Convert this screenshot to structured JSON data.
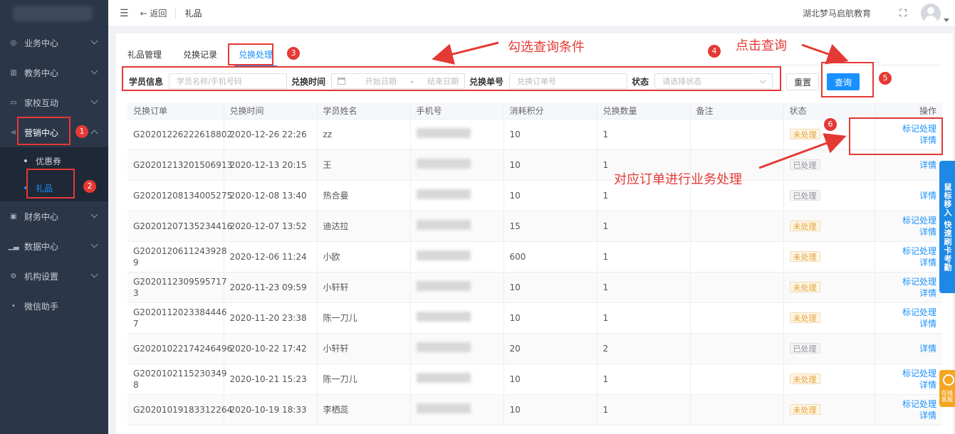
{
  "sidebar": {
    "items": [
      {
        "label": "业务中心",
        "icon": "briefcase-icon"
      },
      {
        "label": "教务中心",
        "icon": "book-icon"
      },
      {
        "label": "家校互动",
        "icon": "chat-icon"
      },
      {
        "label": "营销中心",
        "icon": "share-icon"
      },
      {
        "label": "财务中心",
        "icon": "wallet-icon"
      },
      {
        "label": "数据中心",
        "icon": "chart-icon"
      },
      {
        "label": "机构设置",
        "icon": "gear-icon"
      },
      {
        "label": "微信助手",
        "icon": "dot-icon"
      }
    ],
    "sub_items": [
      "优惠券",
      "礼品"
    ]
  },
  "header": {
    "back_label": "← 返回",
    "crumb": "礼品",
    "org_name": "湖北梦马启航教育"
  },
  "tabs": [
    "礼品管理",
    "兑换记录",
    "兑换处理"
  ],
  "filters": {
    "student_label": "学员信息",
    "student_placeholder": "学员名称/手机号码",
    "time_label": "兑换时间",
    "start_placeholder": "开始日期",
    "range_sep": "-",
    "end_placeholder": "结束日期",
    "order_label": "兑换单号",
    "order_placeholder": "兑换订单号",
    "status_label": "状态",
    "status_placeholder": "请选择状态",
    "reset_label": "重置",
    "query_label": "查询"
  },
  "table": {
    "headers": [
      "兑换订单",
      "兑换时间",
      "学员姓名",
      "手机号",
      "消耗积分",
      "兑换数量",
      "备注",
      "状态",
      "操作"
    ],
    "rows": [
      {
        "order": "G20201226222618802",
        "time": "2020-12-26 22:26",
        "name": "zz",
        "points": "10",
        "qty": "1",
        "status": "未处理",
        "mark": "标记处理",
        "detail": "详情"
      },
      {
        "order": "G20201213201506913",
        "time": "2020-12-13 20:15",
        "name": "王",
        "points": "10",
        "qty": "1",
        "status": "已处理",
        "mark": "",
        "detail": "详情"
      },
      {
        "order": "G20201208134005275",
        "time": "2020-12-08 13:40",
        "name": "热合曼",
        "points": "10",
        "qty": "1",
        "status": "已处理",
        "mark": "",
        "detail": "详情"
      },
      {
        "order": "G20201207135234416",
        "time": "2020-12-07 13:52",
        "name": "迪达拉",
        "points": "15",
        "qty": "1",
        "status": "未处理",
        "mark": "标记处理",
        "detail": "详情"
      },
      {
        "order": "G2020120611243928 9",
        "time": "2020-12-06 11:24",
        "name": "小欧",
        "points": "600",
        "qty": "1",
        "status": "未处理",
        "mark": "标记处理",
        "detail": "详情"
      },
      {
        "order": "G2020112309595717 3",
        "time": "2020-11-23 09:59",
        "name": "小轩轩",
        "points": "10",
        "qty": "1",
        "status": "未处理",
        "mark": "标记处理",
        "detail": "详情"
      },
      {
        "order": "G2020112023384446 7",
        "time": "2020-11-20 23:38",
        "name": "陈一刀儿",
        "points": "10",
        "qty": "1",
        "status": "未处理",
        "mark": "标记处理",
        "detail": "详情"
      },
      {
        "order": "G20201022174246496",
        "time": "2020-10-22 17:42",
        "name": "小轩轩",
        "points": "20",
        "qty": "2",
        "status": "已处理",
        "mark": "",
        "detail": "详情"
      },
      {
        "order": "G2020102115230349 8",
        "time": "2020-10-21 15:23",
        "name": "陈一刀儿",
        "points": "10",
        "qty": "1",
        "status": "未处理",
        "mark": "标记处理",
        "detail": "详情"
      },
      {
        "order": "G20201019183312264",
        "time": "2020-10-19 18:33",
        "name": "李栖蕊",
        "points": "10",
        "qty": "1",
        "status": "未处理",
        "mark": "标记处理",
        "detail": "详情"
      }
    ]
  },
  "annotations": {
    "filter_hint": "勾选查询条件",
    "query_hint": "点击查询",
    "process_hint": "对应订单进行业务处理",
    "numbers": [
      "1",
      "2",
      "3",
      "4",
      "5",
      "6"
    ]
  },
  "float_bar": {
    "label": "鼠标移入 快速刷卡考勤",
    "service": "在线客服"
  }
}
